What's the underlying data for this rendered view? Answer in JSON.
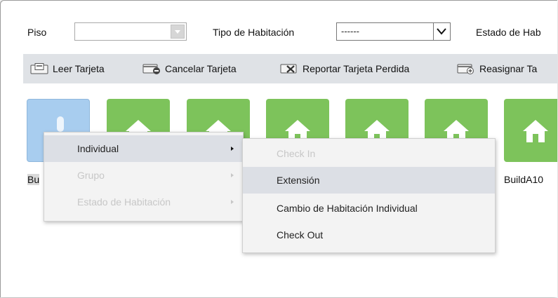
{
  "filters": {
    "piso_label": "Piso",
    "piso_value": "",
    "tipo_label": "Tipo de Habitación",
    "tipo_value": "------",
    "estado_label": "Estado de Hab"
  },
  "toolbar": {
    "items": [
      {
        "label": "Leer Tarjeta",
        "icon": "read-card-icon"
      },
      {
        "label": "Cancelar Tarjeta",
        "icon": "cancel-card-icon"
      },
      {
        "label": "Reportar Tarjeta Perdida",
        "icon": "report-lost-card-icon"
      },
      {
        "label": "Reasignar Ta",
        "icon": "reassign-card-icon"
      }
    ]
  },
  "rooms": {
    "selected_caption": "Bu",
    "last_caption": "BuildA10"
  },
  "context_menu": {
    "items": [
      {
        "label": "Individual",
        "state": "highlighted",
        "has_submenu": true
      },
      {
        "label": "Grupo",
        "state": "disabled",
        "has_submenu": true
      },
      {
        "label": "Estado de Habitación",
        "state": "disabled",
        "has_submenu": true
      }
    ]
  },
  "submenu": {
    "items": [
      {
        "label": "Check In",
        "state": "disabled"
      },
      {
        "label": "Extensión",
        "state": "highlighted"
      },
      {
        "label": "Cambio de Habitación Individual",
        "state": "normal"
      },
      {
        "label": "Check Out",
        "state": "normal"
      }
    ]
  },
  "colors": {
    "tile_green": "#7dc35b",
    "tile_selected": "#a8cdef",
    "toolbar_bg": "#dfe2e6",
    "menu_bg": "#f3f3f3",
    "menu_highlight": "#dcdfe5",
    "disabled_text": "#c7c7c7"
  }
}
